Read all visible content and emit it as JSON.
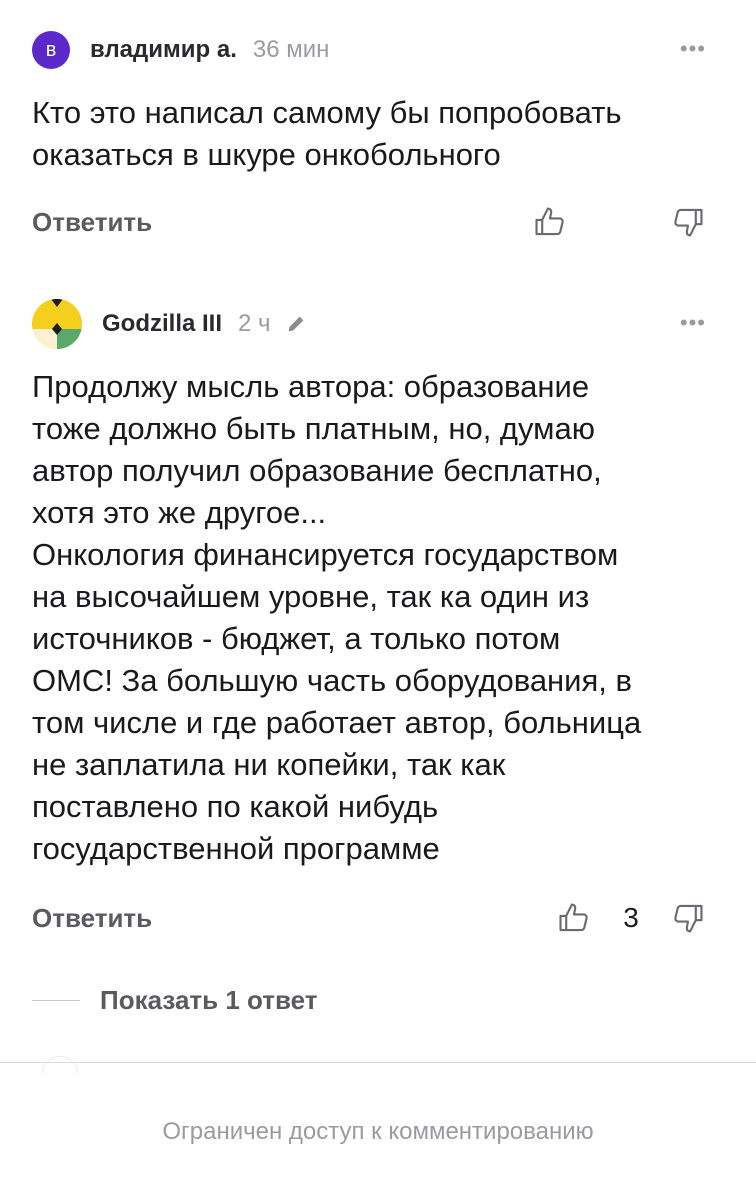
{
  "comments": [
    {
      "avatar_letter": "в",
      "avatar_color": "#5b28c9",
      "author": "владимир а.",
      "time": "36 мин",
      "more_label": "•••",
      "lines": [
        "Кто это написал самому бы попробовать",
        "оказаться в шкуре онкобольного"
      ],
      "reply_label": "Ответить",
      "like_count": ""
    },
    {
      "author": "Godzilla III",
      "time": "2 ч",
      "edited_icon": "pencil-icon",
      "more_label": "•••",
      "lines": [
        "Продолжу мысль автора: образование",
        "тоже должно быть платным, но, думаю",
        "автор получил образование бесплатно,",
        "хотя это же другое...",
        "Онкология финансируется государством",
        "на высочайшем уровне, так ка один из",
        "источников - бюджет, а только потом",
        "ОМС! За большую часть оборудования, в",
        "том числе и где работает автор, больница",
        "не заплатила ни копейки, так как",
        "поставлено по какой нибудь",
        "государственной программе"
      ],
      "reply_label": "Ответить",
      "like_count": "3"
    }
  ],
  "show_replies_label": "Показать 1 ответ",
  "restricted_notice": "Ограничен доступ к комментированию",
  "icons": {
    "like": "thumbs-up-icon",
    "dislike": "thumbs-down-icon",
    "more": "more-dots-icon"
  },
  "colors": {
    "accent_avatar": "#5b28c9",
    "muted_text": "#9a9aa0",
    "action_text": "#5a5a5f"
  }
}
